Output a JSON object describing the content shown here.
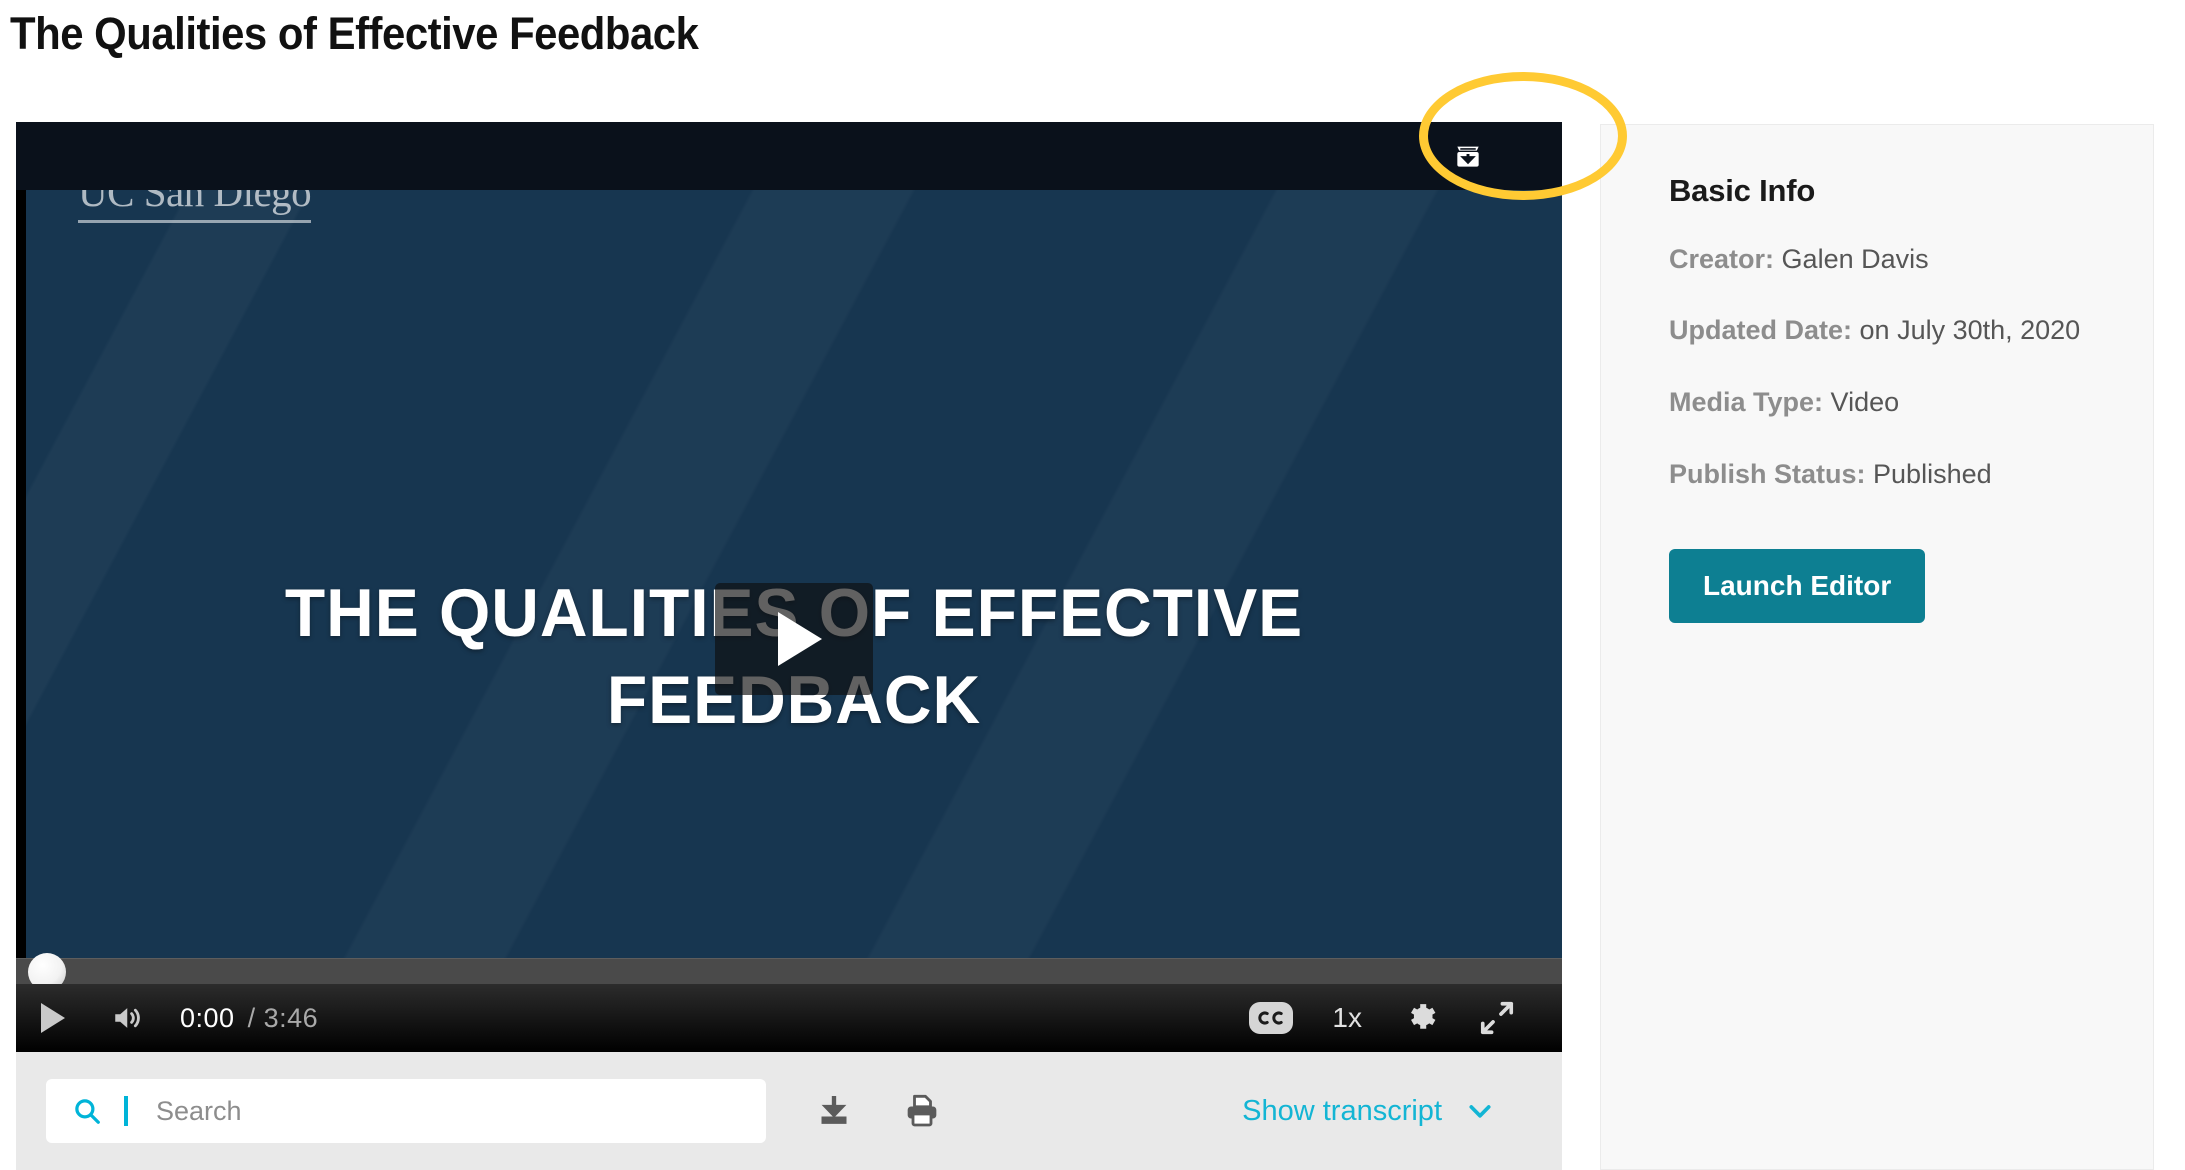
{
  "page": {
    "title": "The Qualities of Effective Feedback"
  },
  "player": {
    "watermark": "UC San Diego",
    "slide_heading_line1": "THE QUALITIES OF EFFECTIVE",
    "slide_heading_line2": "FEEDBACK",
    "download_icon": "download-tray-icon",
    "play_overlay_icon": "play-icon",
    "controls": {
      "play_icon": "play-icon",
      "volume_icon": "volume-icon",
      "current_time": "0:00",
      "duration": "/ 3:46",
      "cc_label": "cc",
      "cc_icon": "closed-caption-icon",
      "speed_label": "1x",
      "settings_icon": "gear-icon",
      "fullscreen_icon": "fullscreen-expand-icon"
    },
    "progress_percent": 0
  },
  "transcript_bar": {
    "search_icon": "search-icon",
    "search_value": "",
    "search_placeholder": "Search",
    "download_icon": "download-icon",
    "print_icon": "printer-icon",
    "show_transcript_label": "Show transcript",
    "chevron_icon": "chevron-down-icon"
  },
  "info_panel": {
    "heading": "Basic Info",
    "rows": [
      {
        "label": "Creator:",
        "value": "Galen Davis"
      },
      {
        "label": "Updated Date:",
        "value": "on July 30th, 2020"
      },
      {
        "label": "Media Type:",
        "value": "Video"
      },
      {
        "label": "Publish Status:",
        "value": "Published"
      }
    ],
    "launch_editor_label": "Launch Editor"
  },
  "annotation": {
    "highlight_shape": "ellipse",
    "highlight_color": "#ffca33",
    "highlight_target": "download-video-button"
  },
  "colors": {
    "accent_teal": "#0d7f92",
    "accent_cyan": "#13b5d4",
    "highlight_yellow": "#ffca33",
    "slide_navy": "#173650",
    "player_topbar": "#0a111b",
    "toolbar_gray": "#e9e9e9",
    "panel_gray": "#f8f8f8"
  }
}
